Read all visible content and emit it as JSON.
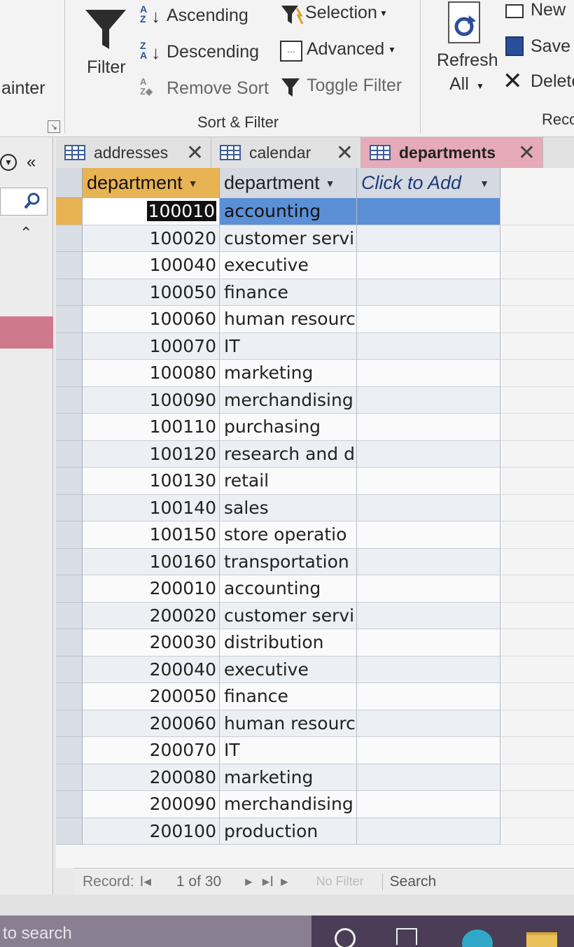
{
  "ribbon": {
    "clipboard_partial": "ainter",
    "filter_label": "Filter",
    "ascending_label": "Ascending",
    "descending_label": "Descending",
    "remove_sort_label": "Remove Sort",
    "selection_label": "Selection",
    "advanced_label": "Advanced",
    "toggle_filter_label": "Toggle Filter",
    "sort_filter_group": "Sort & Filter",
    "refresh_label_1": "Refresh",
    "refresh_label_2": "All",
    "new_label": "New",
    "save_label": "Save",
    "delete_label": "Delete",
    "records_group_partial": "Reco"
  },
  "nav": {
    "collapse_symbol": "«"
  },
  "tabs": [
    {
      "label": "addresses"
    },
    {
      "label": "calendar"
    },
    {
      "label": "departments"
    }
  ],
  "columns": [
    "department",
    "department",
    "Click to Add"
  ],
  "rows": [
    {
      "id": "100010",
      "name": "accounting"
    },
    {
      "id": "100020",
      "name": "customer servi"
    },
    {
      "id": "100040",
      "name": "executive"
    },
    {
      "id": "100050",
      "name": "finance"
    },
    {
      "id": "100060",
      "name": "human resourc"
    },
    {
      "id": "100070",
      "name": "IT"
    },
    {
      "id": "100080",
      "name": "marketing"
    },
    {
      "id": "100090",
      "name": "merchandising"
    },
    {
      "id": "100110",
      "name": "purchasing"
    },
    {
      "id": "100120",
      "name": "research and d"
    },
    {
      "id": "100130",
      "name": "retail"
    },
    {
      "id": "100140",
      "name": "sales"
    },
    {
      "id": "100150",
      "name": "store operatio"
    },
    {
      "id": "100160",
      "name": "transportation"
    },
    {
      "id": "200010",
      "name": "accounting"
    },
    {
      "id": "200020",
      "name": "customer servi"
    },
    {
      "id": "200030",
      "name": "distribution"
    },
    {
      "id": "200040",
      "name": "executive"
    },
    {
      "id": "200050",
      "name": "finance"
    },
    {
      "id": "200060",
      "name": "human resourc"
    },
    {
      "id": "200070",
      "name": "IT"
    },
    {
      "id": "200080",
      "name": "marketing"
    },
    {
      "id": "200090",
      "name": "merchandising"
    },
    {
      "id": "200100",
      "name": "production"
    }
  ],
  "record_nav": {
    "label": "Record:",
    "position": "1 of 30",
    "no_filter": "No Filter",
    "search": "Search"
  },
  "taskbar": {
    "search_partial": "to search"
  },
  "colors": {
    "active_tab": "#e6aab8",
    "header_highlight": "#e8b352",
    "selection_blue": "#5b8fd6",
    "link_blue": "#1f3a78"
  },
  "icons": [
    "filter-funnel-icon",
    "sort-ascending-icon",
    "sort-descending-icon",
    "remove-sort-icon",
    "selection-filter-icon",
    "advanced-filter-icon",
    "toggle-filter-icon",
    "refresh-icon",
    "new-record-icon",
    "save-icon",
    "delete-icon",
    "table-icon",
    "close-icon",
    "search-icon",
    "chevron-down-icon"
  ]
}
